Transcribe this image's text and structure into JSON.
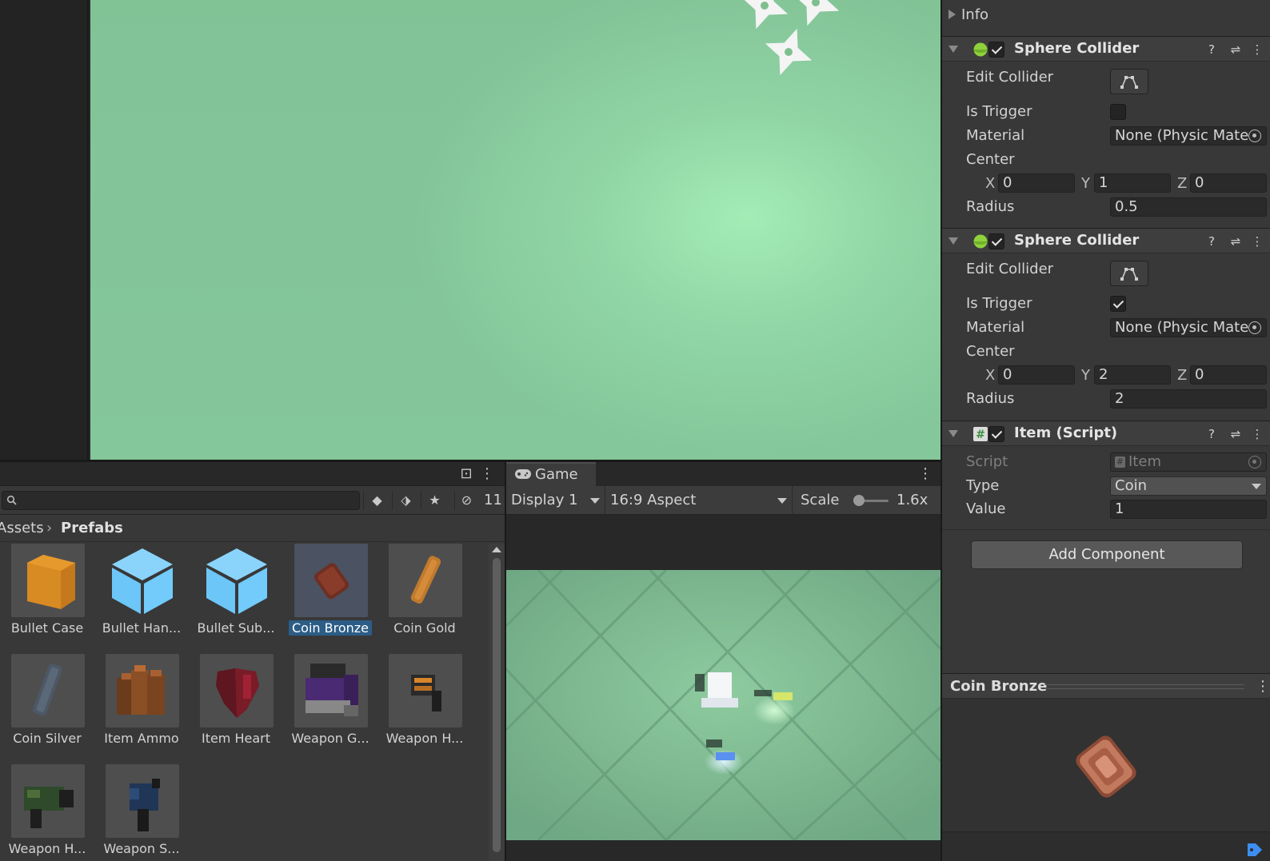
{
  "project": {
    "search_placeholder": "",
    "hidden_count": "11",
    "breadcrumb": {
      "root": "Assets",
      "separator": "›",
      "current": "Prefabs"
    },
    "assets": [
      {
        "label": "Bullet Case",
        "icon": "orange-cube"
      },
      {
        "label": "Bullet Han...",
        "icon": "blue-cube"
      },
      {
        "label": "Bullet Sub...",
        "icon": "blue-cube"
      },
      {
        "label": "Coin Bronze",
        "icon": "bronze-coin",
        "selected": true
      },
      {
        "label": "Coin Gold",
        "icon": "gold-coin"
      },
      {
        "label": "Coin Silver",
        "icon": "silver-coin"
      },
      {
        "label": "Item Ammo",
        "icon": "ammo"
      },
      {
        "label": "Item Heart",
        "icon": "heart"
      },
      {
        "label": "Weapon G...",
        "icon": "weapon-purple"
      },
      {
        "label": "Weapon H...",
        "icon": "weapon-orange"
      },
      {
        "label": "Weapon H...",
        "icon": "weapon-green"
      },
      {
        "label": "Weapon S...",
        "icon": "weapon-blue"
      }
    ]
  },
  "game": {
    "tab_label": "Game",
    "display": "Display 1",
    "aspect": "16:9 Aspect",
    "scale_label": "Scale",
    "scale_value": "1.6x"
  },
  "inspector": {
    "info_label": "Info",
    "components": [
      {
        "title": "Sphere Collider",
        "enabled": true,
        "edit_collider_label": "Edit Collider",
        "is_trigger_label": "Is Trigger",
        "is_trigger": false,
        "material_label": "Material",
        "material_value": "None (Physic Mate",
        "center_label": "Center",
        "center": {
          "x": "0",
          "y": "1",
          "z": "0"
        },
        "radius_label": "Radius",
        "radius": "0.5"
      },
      {
        "title": "Sphere Collider",
        "enabled": true,
        "edit_collider_label": "Edit Collider",
        "is_trigger_label": "Is Trigger",
        "is_trigger": true,
        "material_label": "Material",
        "material_value": "None (Physic Mate",
        "center_label": "Center",
        "center": {
          "x": "0",
          "y": "2",
          "z": "0"
        },
        "radius_label": "Radius",
        "radius": "2"
      }
    ],
    "script_component": {
      "title": "Item (Script)",
      "script_label": "Script",
      "script_value": "Item",
      "type_label": "Type",
      "type_value": "Coin",
      "value_label": "Value",
      "value": "1"
    },
    "axis_labels": {
      "x": "X",
      "y": "Y",
      "z": "Z"
    },
    "add_component_label": "Add Component",
    "preview_title": "Coin Bronze"
  },
  "colors": {
    "accent_selection": "#2c5d87",
    "collider_icon": "#8fd13b",
    "scene_green": "#93d9a8"
  }
}
